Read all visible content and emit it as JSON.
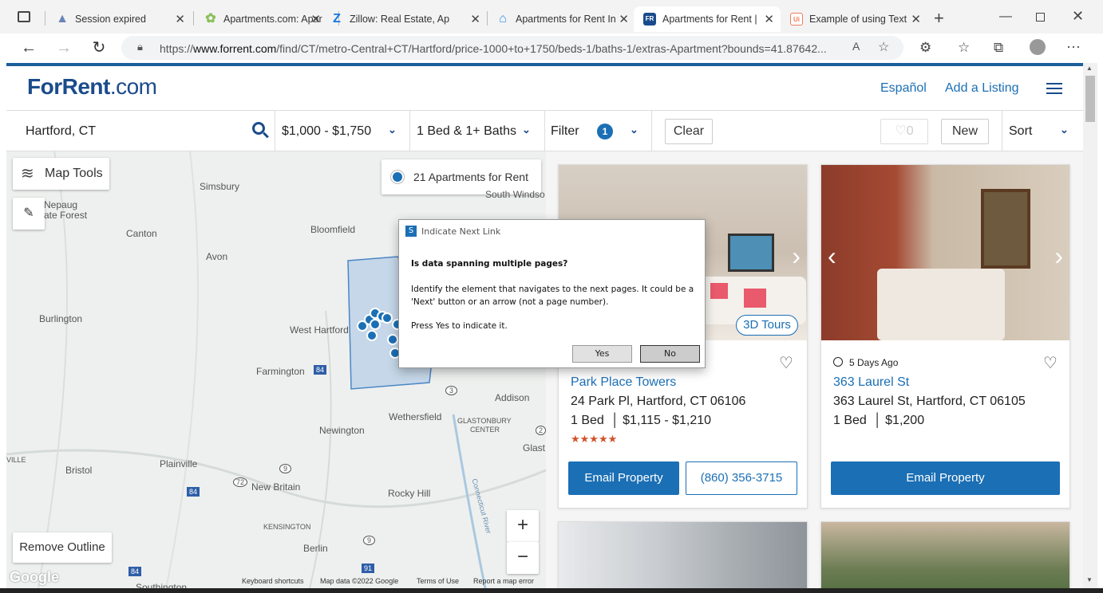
{
  "browser": {
    "tabs": [
      {
        "title": "Session expired",
        "icon": "activity-icon",
        "color": "#6a83b8"
      },
      {
        "title": "Apartments.com: Apar",
        "icon": "apartments-leaf-icon",
        "color": "#8bbf5a"
      },
      {
        "title": "Zillow: Real Estate, Ap",
        "icon": "zillow-icon",
        "color": "#1277e1"
      },
      {
        "title": "Apartments for Rent In",
        "icon": "house-icon",
        "color": "#2a8ef0"
      },
      {
        "title": "Apartments for Rent |",
        "icon": "forrent-icon",
        "color": "#1a4b8c",
        "fav": "FR"
      },
      {
        "title": "Example of using Text",
        "icon": "uipath-icon",
        "color": "#f27c5c",
        "fav": "Ui"
      }
    ],
    "url_prefix": "https://",
    "url_host": "www.forrent.com",
    "url_rest": "/find/CT/metro-Central+CT/Hartford/price-1000+to+1750/beds-1/baths-1/extras-Apartment?bounds=41.87642..."
  },
  "header": {
    "logo_main": "ForRent",
    "logo_suffix": ".com",
    "link_espanol": "Español",
    "link_add": "Add a Listing"
  },
  "filters": {
    "location": "Hartford, CT",
    "price": "$1,000 - $1,750",
    "beds": "1 Bed & 1+ Baths",
    "filter_label": "Filter",
    "filter_count": "1",
    "clear": "Clear",
    "favorites_count": "0",
    "new": "New",
    "sort": "Sort"
  },
  "map": {
    "tools": "Map Tools",
    "count_label": "21 Apartments for Rent",
    "remove_outline": "Remove Outline",
    "labels": [
      "Simsbury",
      "Nepaug",
      "ate Forest",
      "Canton",
      "Bloomfield",
      "Avon",
      "Burlington",
      "West Hartford",
      "Farmington",
      "Addison",
      "Wethersfield",
      "Newington",
      "GLASTONBURY",
      "CENTER",
      "Glast",
      "VILLE",
      "Bristol",
      "Plainville",
      "New Britain",
      "Rocky Hill",
      "KENSINGTON",
      "Berlin",
      "Southington",
      "South Windso",
      "Connecticut River"
    ],
    "route_labels": [
      "84",
      "3",
      "9",
      "72",
      "84",
      "9",
      "91",
      "84",
      "2"
    ],
    "footer": [
      "Keyboard shortcuts",
      "Map data ©2022 Google",
      "Terms of Use",
      "Report a map error"
    ],
    "google": "Google"
  },
  "listings": [
    {
      "tour": "3D Tours",
      "name": "Park Place Towers",
      "address": "24 Park Pl, Hartford, CT 06106",
      "beds": "1 Bed",
      "price": "$1,115 - $1,210",
      "stars": "★★★★★",
      "email": "Email Property",
      "phone": "(860) 356-3715"
    },
    {
      "updated": "5 Days Ago",
      "name": "363 Laurel St",
      "address": "363 Laurel St, Hartford, CT 06105",
      "beds": "1 Bed",
      "price": "$1,200",
      "email": "Email Property"
    }
  ],
  "dialog": {
    "title": "Indicate Next Link",
    "question": "Is data spanning multiple pages?",
    "body": "Identify the element that navigates to the next pages. It could be a 'Next' button or an arrow (not a page number).",
    "hint": "Press Yes to indicate it.",
    "yes": "Yes",
    "no": "No"
  }
}
